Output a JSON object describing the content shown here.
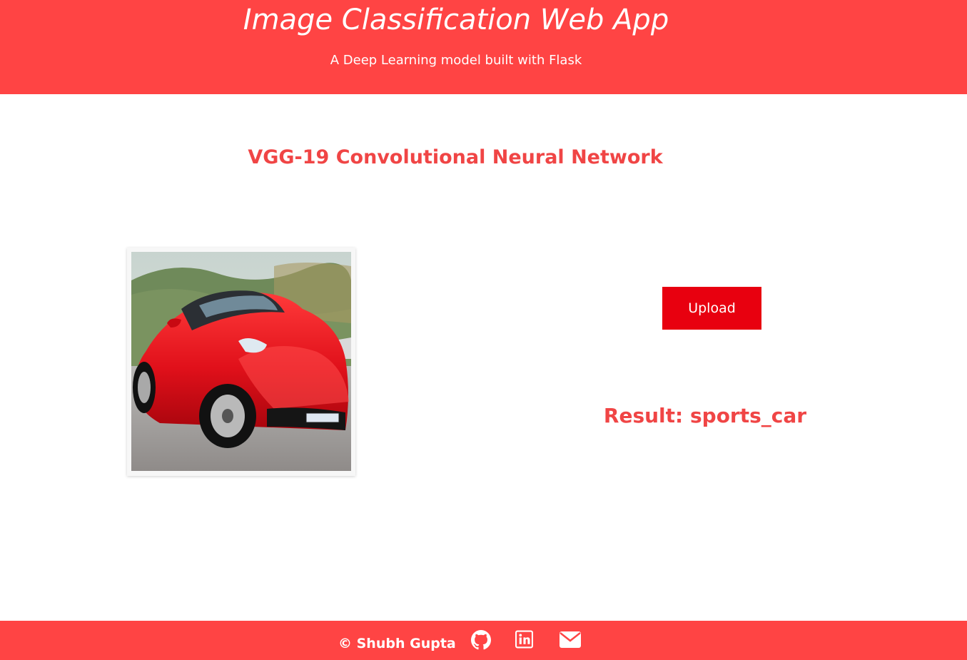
{
  "header": {
    "title": "Image Classification Web App",
    "subtitle": "A Deep Learning model built with Flask"
  },
  "main": {
    "model_title": "VGG-19 Convolutional Neural Network",
    "upload_label": "Upload",
    "result_text": "Result: sports_car",
    "image_icon": "uploaded-car-photo"
  },
  "footer": {
    "copyright": "© Shubh Gupta",
    "icons": [
      "github-icon",
      "linkedin-icon",
      "email-icon"
    ]
  },
  "colors": {
    "brand": "#ff4444",
    "accent_text": "#f04545",
    "button": "#e8000f",
    "background": "#ffffff"
  }
}
